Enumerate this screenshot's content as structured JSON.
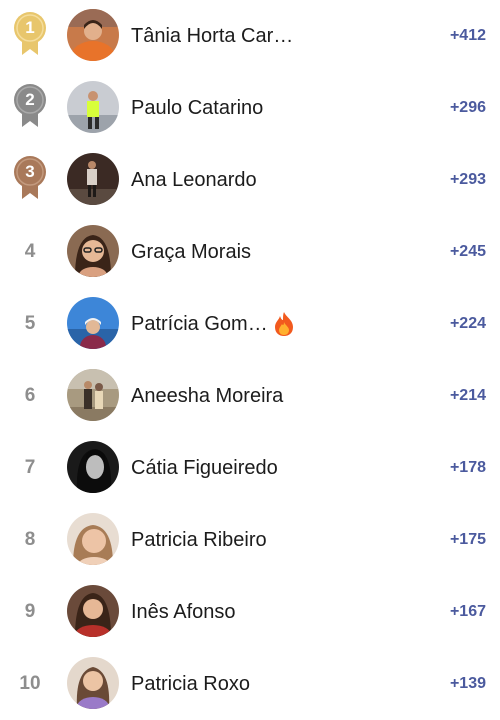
{
  "medal_colors": {
    "gold": "#e8c66c",
    "silver": "#8a8a8a",
    "bronze": "#a9795a"
  },
  "points_color": "#4b5a9e",
  "rows": [
    {
      "rank": "1",
      "name": "Tânia Horta Car…",
      "points": "+412",
      "medal": "gold"
    },
    {
      "rank": "2",
      "name": "Paulo Catarino",
      "points": "+296",
      "medal": "silver"
    },
    {
      "rank": "3",
      "name": "Ana Leonardo",
      "points": "+293",
      "medal": "bronze"
    },
    {
      "rank": "4",
      "name": "Graça Morais",
      "points": "+245"
    },
    {
      "rank": "5",
      "name": "Patrícia Gom…",
      "points": "+224",
      "icon": "fire-icon"
    },
    {
      "rank": "6",
      "name": "Aneesha Moreira",
      "points": "+214"
    },
    {
      "rank": "7",
      "name": "Cátia Figueiredo",
      "points": "+178"
    },
    {
      "rank": "8",
      "name": "Patricia Ribeiro",
      "points": "+175"
    },
    {
      "rank": "9",
      "name": "Inês Afonso",
      "points": "+167"
    },
    {
      "rank": "10",
      "name": "Patricia Roxo",
      "points": "+139"
    }
  ]
}
